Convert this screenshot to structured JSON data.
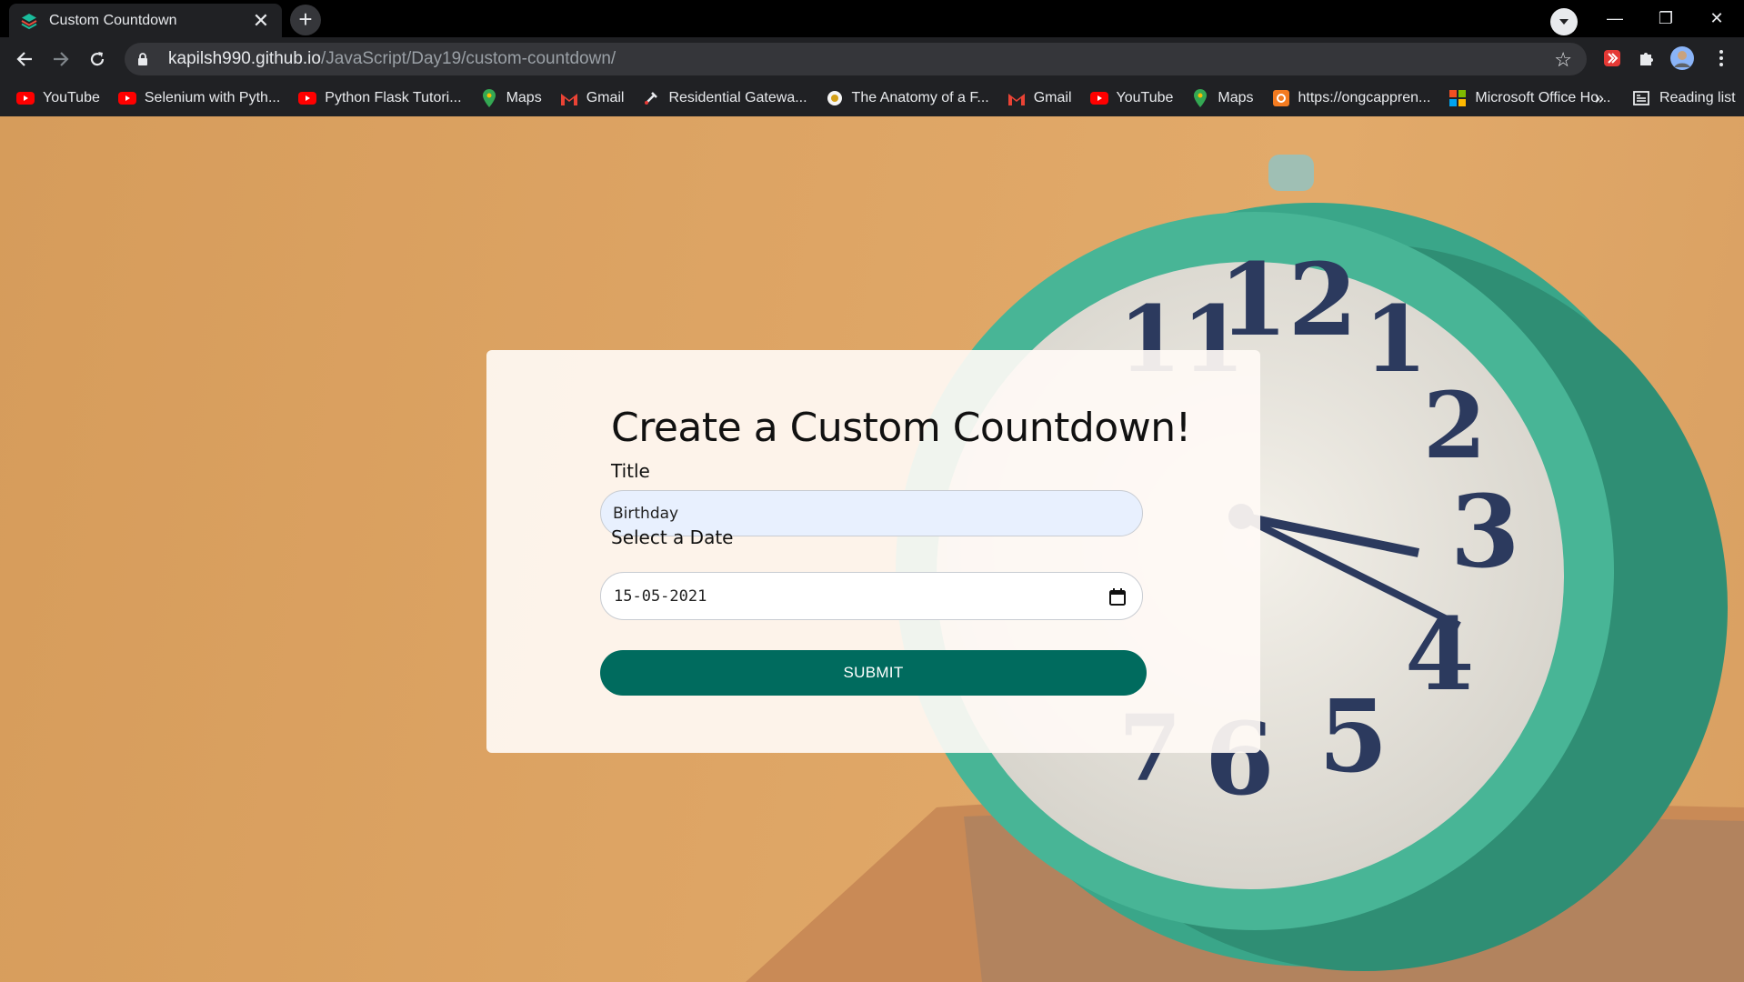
{
  "browser": {
    "tab": {
      "title": "Custom Countdown",
      "close_glyph": "✕"
    },
    "new_tab_glyph": "+",
    "address": {
      "host": "kapilsh990.github.io",
      "path": "/JavaScript/Day19/custom-countdown/"
    },
    "window_controls": {
      "minimize": "—",
      "restore": "❐",
      "close": "✕"
    },
    "bookmarks": [
      {
        "label": "YouTube",
        "icon": "youtube-icon",
        "color": "#ff0000"
      },
      {
        "label": "Selenium with Pyth...",
        "icon": "youtube-icon",
        "color": "#ff0000"
      },
      {
        "label": "Python Flask Tutori...",
        "icon": "youtube-icon",
        "color": "#ff0000"
      },
      {
        "label": "Maps",
        "icon": "maps-icon",
        "color": "#34a853"
      },
      {
        "label": "Gmail",
        "icon": "gmail-icon",
        "color": "#ea4335"
      },
      {
        "label": "Residential Gatewa...",
        "icon": "tool-icon",
        "color": "#e8eaed"
      },
      {
        "label": "The Anatomy of a F...",
        "icon": "circle-icon",
        "color": "#f5f5f5"
      },
      {
        "label": "Gmail",
        "icon": "gmail-icon",
        "color": "#ea4335"
      },
      {
        "label": "YouTube",
        "icon": "youtube-icon",
        "color": "#ff0000"
      },
      {
        "label": "Maps",
        "icon": "maps-icon",
        "color": "#34a853"
      },
      {
        "label": "https://ongcappren...",
        "icon": "ongc-icon",
        "color": "#f47b20"
      },
      {
        "label": "Microsoft Office Ho...",
        "icon": "microsoft-icon",
        "color": "#f25022"
      }
    ],
    "bookmarks_overflow": "»",
    "reading_list": "Reading list"
  },
  "page": {
    "heading": "Create a Custom Countdown!",
    "title_label": "Title",
    "title_value": "Birthday",
    "date_label": "Select a Date",
    "date_value": "15-05-2021",
    "submit_label": "SUBMIT",
    "accent": "#006b5e"
  }
}
